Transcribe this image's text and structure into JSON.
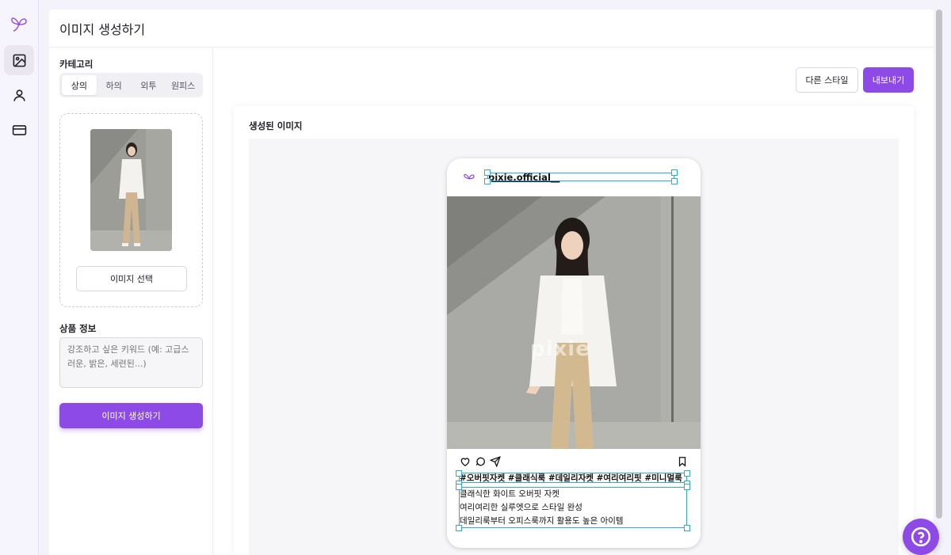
{
  "header": {
    "title": "이미지 생성하기"
  },
  "panel": {
    "category_label": "카테고리",
    "categories": [
      {
        "label": "상의",
        "active": true
      },
      {
        "label": "하의",
        "active": false
      },
      {
        "label": "외투",
        "active": false
      },
      {
        "label": "원피스",
        "active": false
      }
    ],
    "select_image_label": "이미지 선택",
    "product_info_label": "상품 정보",
    "keyword_placeholder": "강조하고 싶은 키워드 (예: 고급스러운, 밝은, 세련된...)",
    "generate_label": "이미지 생성하기"
  },
  "toolbar": {
    "other_style_label": "다른 스타일",
    "export_label": "내보내기"
  },
  "result": {
    "title": "생성된 이미지",
    "post": {
      "handle": "pixie.official__",
      "watermark": "pixie",
      "hashtags": "#오버핏자켓 #클래식룩 #데일리자켓 #여리여리핏 #미니멀룩",
      "caption_lines": [
        "클래식한 화이트 오버핏 자켓",
        "여리여리한 실루엣으로 스타일 완성",
        "데일리룩부터 오피스룩까지 활용도 높은 아이템"
      ]
    }
  },
  "colors": {
    "accent": "#8e4ae6",
    "selection": "#36a7cf"
  },
  "icons": [
    "butterfly-logo-icon",
    "image-icon",
    "user-icon",
    "credit-card-icon",
    "heart-icon",
    "comment-icon",
    "send-icon",
    "bookmark-icon",
    "help-icon"
  ]
}
